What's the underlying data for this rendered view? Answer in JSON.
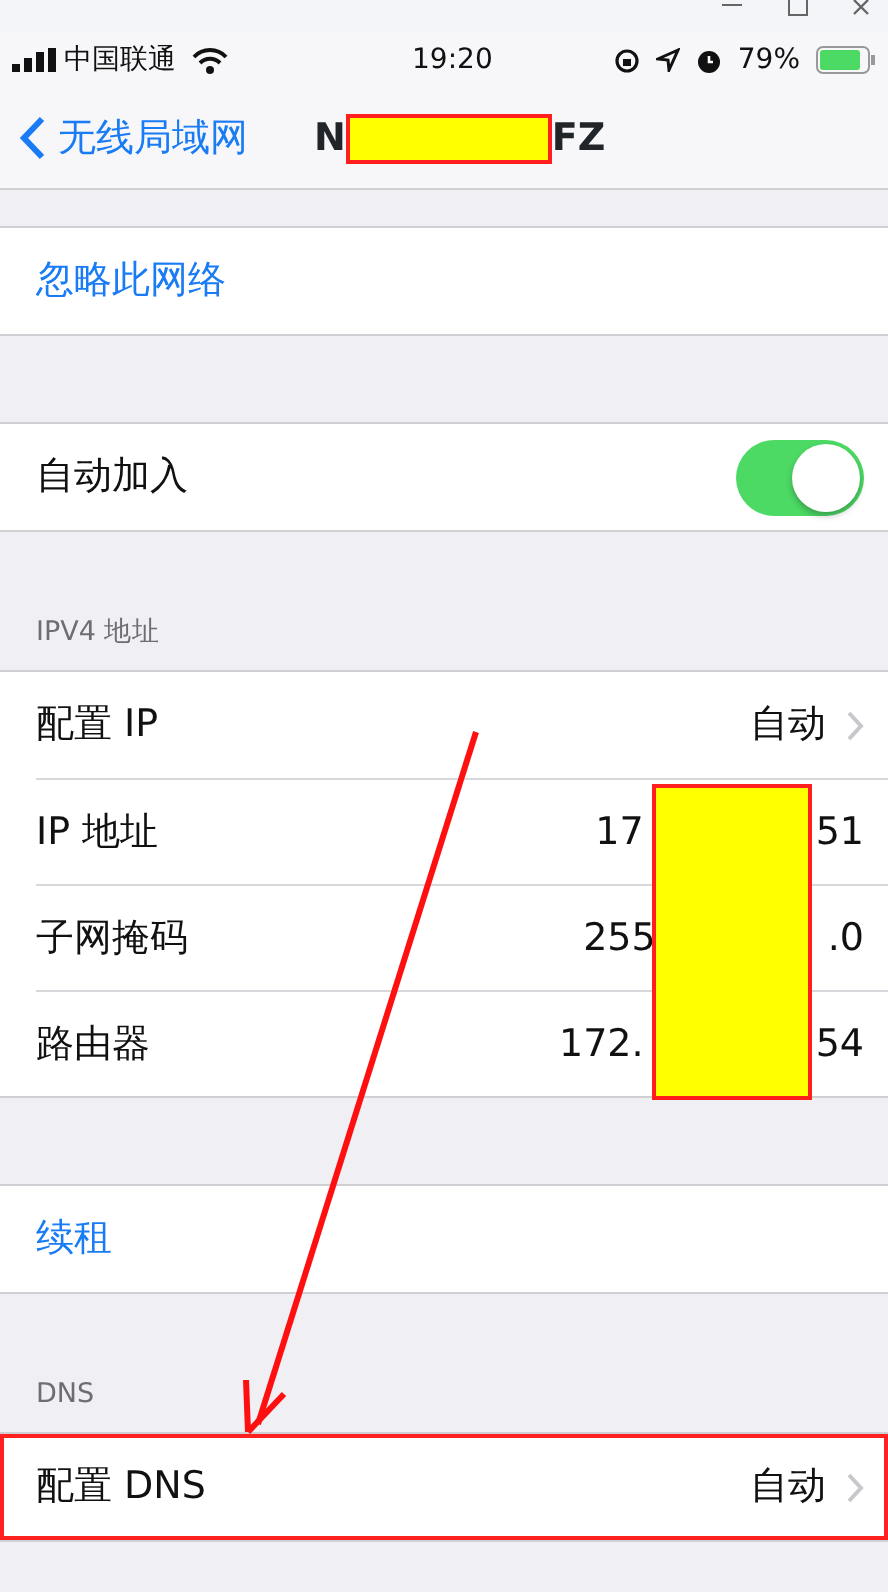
{
  "status_bar": {
    "carrier": "中国联通",
    "time": "19:20",
    "battery": "79%"
  },
  "nav": {
    "back": "无线局域网",
    "title_parts": [
      "N",
      "FZ"
    ]
  },
  "sections": [
    {
      "rows": [
        {
          "kind": "action",
          "label": "忽略此网络"
        }
      ]
    },
    {
      "rows": [
        {
          "kind": "toggle",
          "label": "自动加入",
          "on": true
        }
      ]
    },
    {
      "header": "IPV4 地址",
      "rows": [
        {
          "kind": "link",
          "label": "配置 IP",
          "value": "自动"
        },
        {
          "kind": "info",
          "label": "IP 地址",
          "value_parts": [
            "17",
            "51"
          ]
        },
        {
          "kind": "info",
          "label": "子网掩码",
          "value_parts": [
            "255",
            ".0"
          ]
        },
        {
          "kind": "info",
          "label": "路由器",
          "value_parts": [
            "172.",
            "54"
          ]
        }
      ]
    },
    {
      "rows": [
        {
          "kind": "action",
          "label": "续租"
        }
      ]
    },
    {
      "header": "DNS",
      "rows": [
        {
          "kind": "link",
          "label": "配置 DNS",
          "value": "自动",
          "highlighted": true
        }
      ]
    }
  ]
}
